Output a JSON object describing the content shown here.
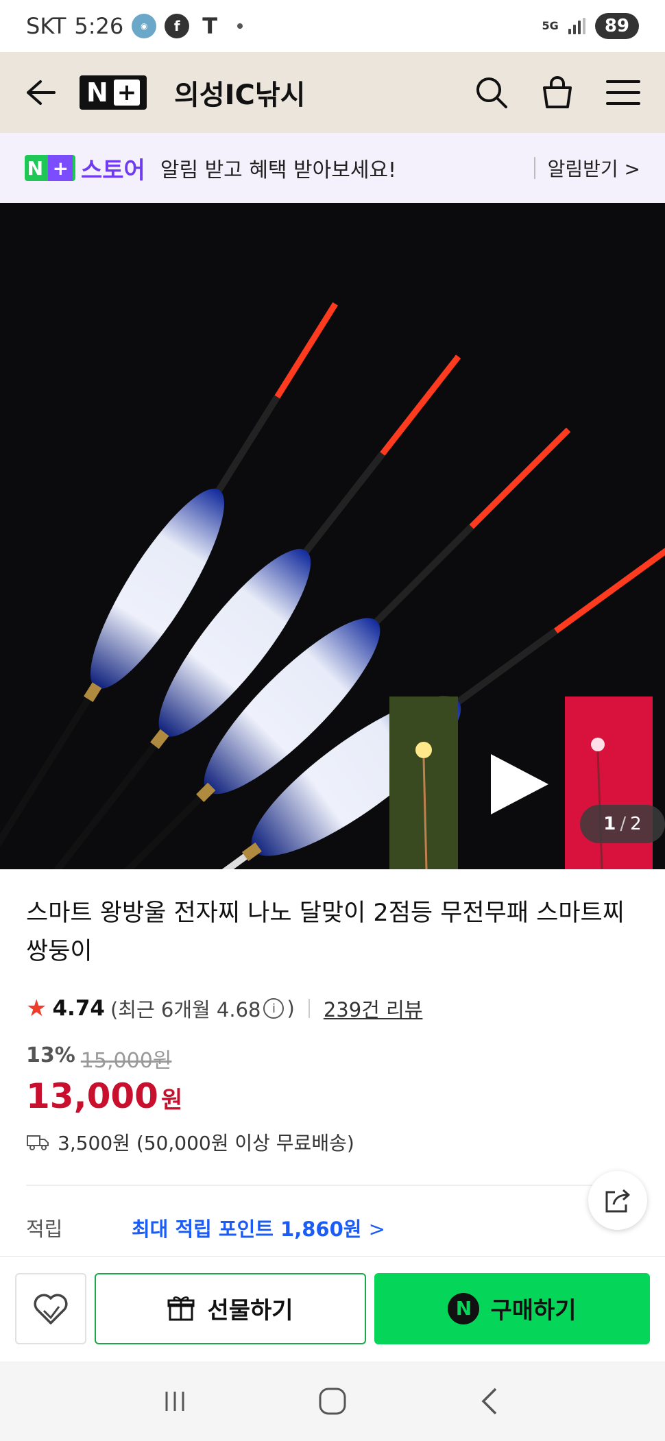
{
  "status_bar": {
    "carrier": "SKT",
    "time": "5:26",
    "network": "5G",
    "battery": "89",
    "icons": [
      "app-notification-icon",
      "facebook-icon",
      "threads-icon",
      "more-dot-icon"
    ]
  },
  "header": {
    "logo_text": "N",
    "logo_plus": "+",
    "store_name": "의성IC낚시",
    "icons": [
      "back-arrow-icon",
      "search-icon",
      "shopping-bag-icon",
      "menu-icon"
    ]
  },
  "notice": {
    "badge_n": "N",
    "badge_plus": "+",
    "store_label": "스토어",
    "message": "알림 받고 혜택 받아보세요!",
    "action": "알림받기 >"
  },
  "image": {
    "counter_current": "1",
    "counter_sep": "/",
    "counter_total": "2"
  },
  "product": {
    "title": "스마트 왕방울 전자찌 나노 달맞이 2점등 무전무패 스마트찌 쌍둥이",
    "rating": "4.74",
    "rating_recent_prefix": "(최근 6개월 4.68",
    "rating_recent_suffix": ")",
    "review_count": "239건 리뷰",
    "discount_rate": "13%",
    "original_price": "15,000원",
    "sale_price": "13,000",
    "currency": "원",
    "shipping": "3,500원 (50,000원 이상 무료배송)",
    "points_label": "적립",
    "points_value": "최대 적립 포인트 1,860원",
    "points_arrow": ">"
  },
  "actions": {
    "gift_label": "선물하기",
    "buy_label": "구매하기",
    "buy_badge": "N"
  },
  "colors": {
    "header_bg": "#ece5db",
    "notice_bg": "#f4f1fd",
    "naver_green": "#05d65a",
    "sale_red": "#c8102e",
    "points_blue": "#1a5cf5",
    "store_purple": "#6e3bf0"
  }
}
